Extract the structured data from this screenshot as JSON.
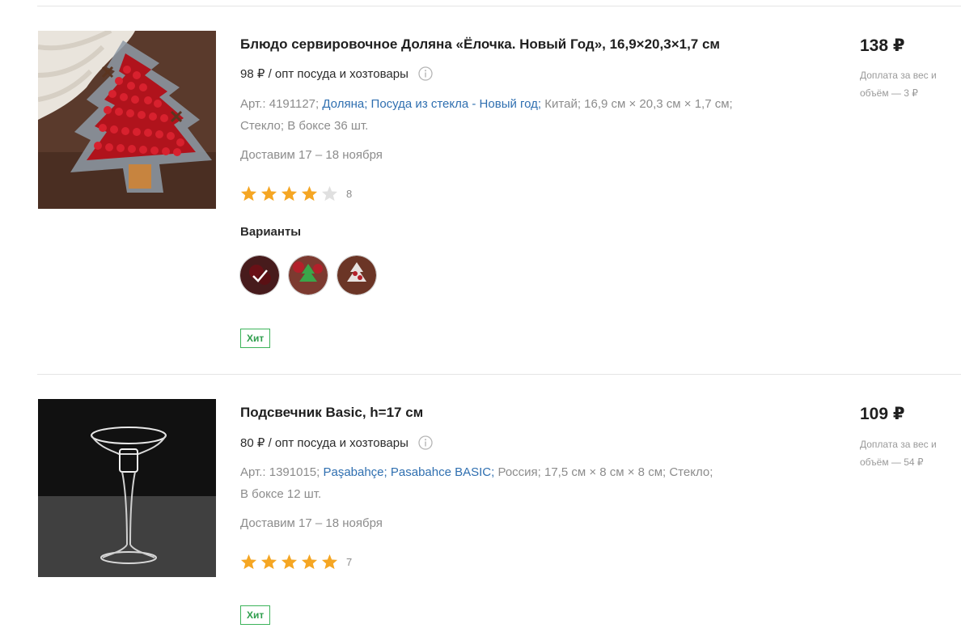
{
  "products": [
    {
      "title": "Блюдо сервировочное Доляна «Ёлочка. Новый Год», 16,9×20,3×1,7 см",
      "opt_price": "98 ₽ / опт посуда и хозтовары",
      "article": "Арт.: 4191127;",
      "brand": "Доляна;",
      "collection": "Посуда из стекла - Новый год;",
      "details_line1": "Китай; 16,9 см × 20,3 см × 1,7 см;",
      "details_line2": "Стекло; В боксе 36 шт.",
      "delivery": "Доставим 17 – 18 ноября",
      "rating": 4,
      "rating_max": 5,
      "reviews_count": "8",
      "variants_label": "Варианты",
      "badge": "Хит",
      "price": "138 ₽",
      "surcharge": "Доплата за вес и объём — 3 ₽"
    },
    {
      "title": "Подсвечник Basic, h=17 см",
      "opt_price": "80 ₽ / опт посуда и хозтовары",
      "article": "Арт.: 1391015;",
      "brand": "Paşabahçe;",
      "collection": "Pasabahce BASIC;",
      "details_line1": "Россия; 17,5 см × 8 см × 8 см; Стекло;",
      "details_line2": "В боксе 12 шт.",
      "delivery": "Доставим 17 – 18 ноября",
      "rating": 5,
      "rating_max": 5,
      "reviews_count": "7",
      "badge": "Хит",
      "price": "109 ₽",
      "surcharge": "Доплата за вес и объём — 54 ₽"
    }
  ],
  "colors": {
    "star_filled": "#f5a623",
    "star_empty": "#e0e0e0",
    "link": "#2f6fb0",
    "badge_green": "#3cb35a"
  }
}
